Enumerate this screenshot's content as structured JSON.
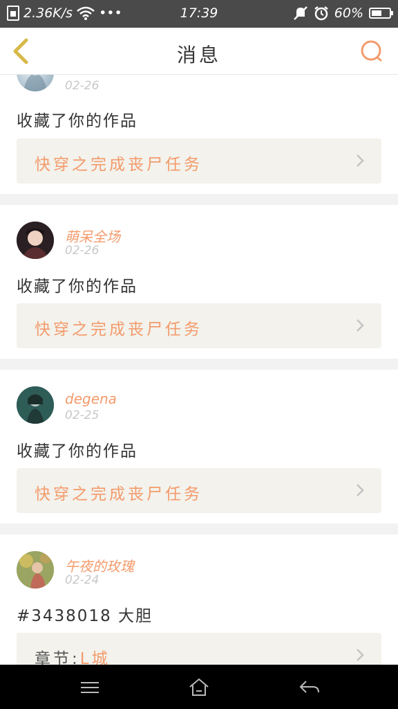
{
  "status_bar": {
    "network_speed": "2.36K/s",
    "dots": "•••",
    "time": "17:39",
    "battery": "60%",
    "battery_level": 0.6
  },
  "header": {
    "title": "消息",
    "accent_color": "#f39b6c"
  },
  "messages": [
    {
      "username": "",
      "date": "02-26",
      "text": "收藏了你的作品",
      "link_prefix": "",
      "link_title": "快穿之完成丧尸任务"
    },
    {
      "username": "萌呆全场",
      "date": "02-26",
      "text": "收藏了你的作品",
      "link_prefix": "",
      "link_title": "快穿之完成丧尸任务"
    },
    {
      "username": "degena",
      "date": "02-25",
      "text": "收藏了你的作品",
      "link_prefix": "",
      "link_title": "快穿之完成丧尸任务"
    },
    {
      "username": "午夜的玫瑰",
      "date": "02-24",
      "text": "#3438018 大胆",
      "link_prefix": "章节:",
      "link_title": "L城"
    }
  ],
  "system_nav": {
    "icons": [
      "menu-icon",
      "home-icon",
      "back-arrow-icon"
    ]
  }
}
